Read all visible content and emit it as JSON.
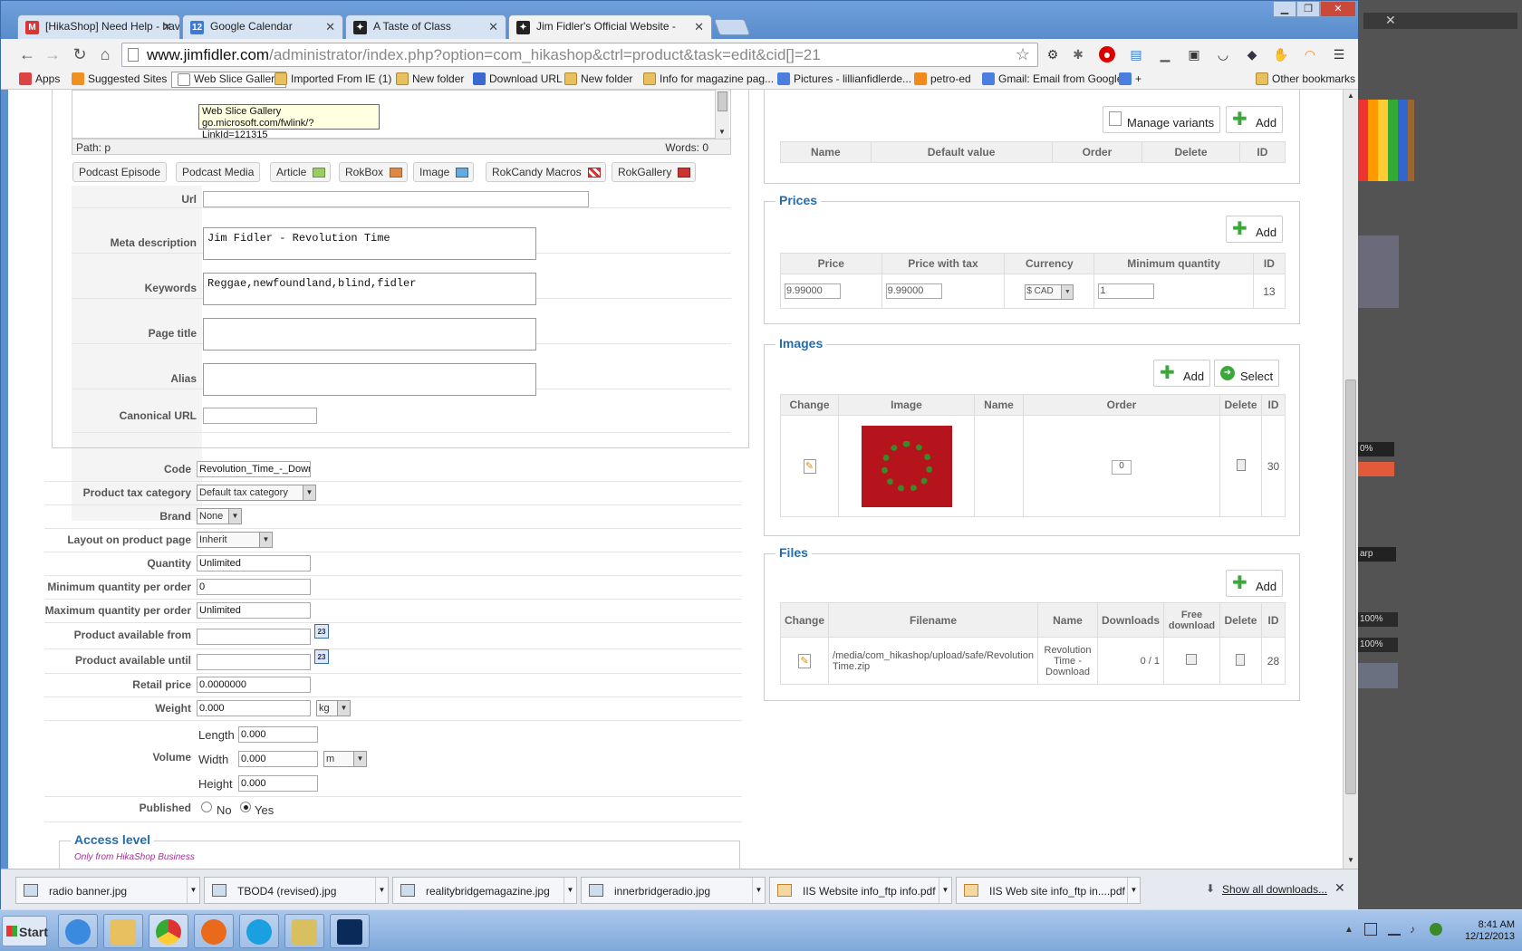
{
  "browser": {
    "tabs": [
      {
        "title": "[HikaShop] Need Help - have",
        "icon": "gmail-icon"
      },
      {
        "title": "Google Calendar",
        "icon": "calendar-icon"
      },
      {
        "title": "A Taste of Class",
        "icon": "joomla-icon"
      },
      {
        "title": "Jim Fidler's Official Website -",
        "icon": "joomla-icon",
        "active": true
      }
    ],
    "url_host": "www.jimfidler.com",
    "url_path": "/administrator/index.php?option=com_hikashop&ctrl=product&task=edit&cid[]=21",
    "bookmarks": [
      {
        "label": "Apps"
      },
      {
        "label": "Suggested Sites"
      },
      {
        "label": "Web Slice Gallery"
      },
      {
        "label": "Imported From IE (1)"
      },
      {
        "label": "New folder"
      },
      {
        "label": "Download URL"
      },
      {
        "label": "New folder"
      },
      {
        "label": "Info for magazine pag..."
      },
      {
        "label": "Pictures - lillianfidlerde..."
      },
      {
        "label": "petro-ed"
      },
      {
        "label": "Gmail: Email from Google"
      },
      {
        "label": "+"
      },
      {
        "label": "Other bookmarks"
      }
    ],
    "tooltip": {
      "line1": "Web Slice Gallery",
      "line2": "go.microsoft.com/fwlink/?LinkId=121315"
    }
  },
  "editor": {
    "path_label": "Path:",
    "path_value": "p",
    "words_label": "Words: 0",
    "plugin_buttons": [
      "Podcast Episode",
      "Podcast Media",
      "Article",
      "RokBox",
      "Image",
      "RokCandy Macros",
      "RokGallery"
    ]
  },
  "seo": {
    "url_label": "Url",
    "meta_label": "Meta description",
    "meta_value": "Jim Fidler - Revolution Time",
    "keywords_label": "Keywords",
    "keywords_value": "Reggae,newfoundland,blind,fidler",
    "page_title_label": "Page title",
    "alias_label": "Alias",
    "canonical_label": "Canonical URL"
  },
  "product": {
    "code_label": "Code",
    "code_value": "Revolution_Time_-_Down",
    "tax_label": "Product tax category",
    "tax_value": "Default tax category",
    "brand_label": "Brand",
    "brand_value": "None",
    "layout_label": "Layout on product page",
    "layout_value": "Inherit",
    "quantity_label": "Quantity",
    "quantity_value": "Unlimited",
    "min_qty_label": "Minimum quantity per order",
    "min_qty_value": "0",
    "max_qty_label": "Maximum quantity per order",
    "max_qty_value": "Unlimited",
    "avail_from_label": "Product available from",
    "avail_until_label": "Product available until",
    "retail_label": "Retail price",
    "retail_value": "0.0000000",
    "weight_label": "Weight",
    "weight_value": "0.000",
    "weight_unit": "kg",
    "volume_label": "Volume",
    "length_label": "Length",
    "length_value": "0.000",
    "width_label": "Width",
    "width_value": "0.000",
    "dim_unit": "m",
    "height_label": "Height",
    "height_value": "0.000",
    "published_label": "Published",
    "no_label": "No",
    "yes_label": "Yes",
    "access_legend": "Access level",
    "access_note": "Only from HikaShop Business",
    "calendar_glyph": "23"
  },
  "characteristics": {
    "manage_label": "Manage variants",
    "add_label": "Add",
    "headers": [
      "Name",
      "Default value",
      "Order",
      "Delete",
      "ID"
    ]
  },
  "prices": {
    "legend": "Prices",
    "add_label": "Add",
    "headers": [
      "Price",
      "Price with tax",
      "Currency",
      "Minimum quantity",
      "ID"
    ],
    "row": {
      "price": "9.99000",
      "price_tax": "9.99000",
      "currency": "$ CAD",
      "min_qty": "1",
      "id": "13"
    }
  },
  "images": {
    "legend": "Images",
    "add_label": "Add",
    "select_label": "Select",
    "headers": [
      "Change",
      "Image",
      "Name",
      "Order",
      "Delete",
      "ID"
    ],
    "row": {
      "order": "0",
      "id": "30"
    }
  },
  "files": {
    "legend": "Files",
    "add_label": "Add",
    "headers": [
      "Change",
      "Filename",
      "Name",
      "Downloads",
      "Free download",
      "Delete",
      "ID"
    ],
    "row": {
      "filename": "/media/com_hikashop/upload/safe/Revolution Time.zip",
      "name": "Revolution Time - Download",
      "downloads": "0 / 1",
      "id": "28"
    }
  },
  "downloads": {
    "items": [
      "radio banner.jpg",
      "TBOD4 (revised).jpg",
      "realitybridgemagazine.jpg",
      "innerbridgeradio.jpg",
      "IIS Website info_ftp info.pdf",
      "IIS Web site info_ftp in....pdf"
    ],
    "show_all": "Show all downloads..."
  },
  "taskbar": {
    "start": "Start",
    "time": "8:41 AM",
    "date": "12/12/2013",
    "ps_zoom_1": "100%",
    "ps_zoom_2": "100%",
    "ps_pct": "0%",
    "ps_blend": "arp"
  },
  "colors": {
    "accent": "#246cac",
    "image_bg": "#b5141c",
    "wreath": "#3a8a2a"
  }
}
